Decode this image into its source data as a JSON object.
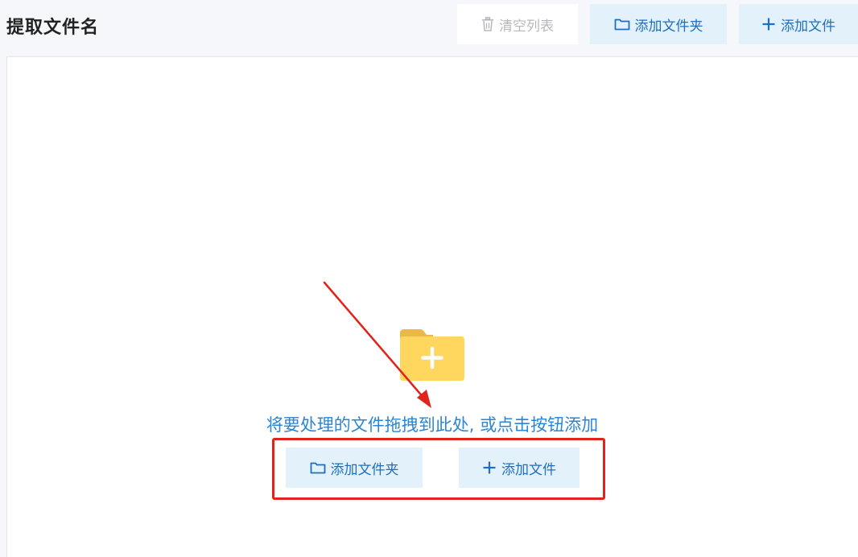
{
  "header": {
    "title": "提取文件名",
    "clear_label": "清空列表",
    "add_folder_label": "添加文件夹",
    "add_file_label": "添加文件"
  },
  "dropzone": {
    "hint": "将要处理的文件拖拽到此处, 或点击按钮添加",
    "add_folder_label": "添加文件夹",
    "add_file_label": "添加文件"
  },
  "icons": {
    "clear": "trash-icon",
    "folder": "folder-icon",
    "add": "plus-icon",
    "illustration": "folder-plus-icon"
  },
  "colors": {
    "accent": "#1e6fbf",
    "hint_text": "#2a86d4",
    "button_bg": "#e3f1fb",
    "folder_yellow": "#ffd75e",
    "annotation_red": "#e0231c"
  }
}
